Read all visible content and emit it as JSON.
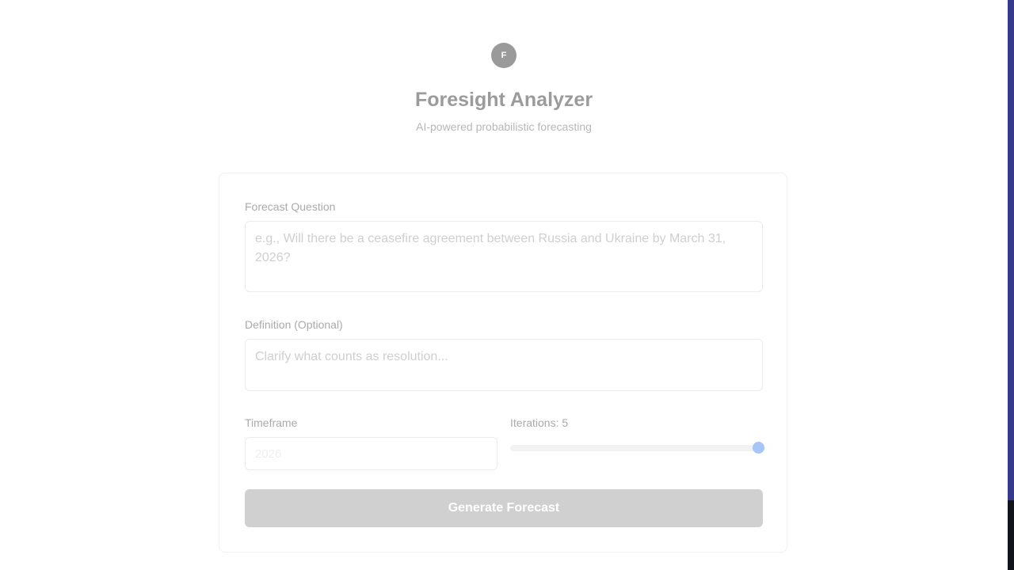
{
  "header": {
    "logo_letter": "F",
    "title": "Foresight Analyzer",
    "subtitle": "AI-powered probabilistic forecasting"
  },
  "form": {
    "question": {
      "label": "Forecast Question",
      "value": "",
      "placeholder": "e.g., Will there be a ceasefire agreement between Russia and Ukraine by March 31, 2026?"
    },
    "definition": {
      "label": "Definition (Optional)",
      "value": "",
      "placeholder": "Clarify what counts as resolution..."
    },
    "timeframe": {
      "label": "Timeframe",
      "value": "",
      "placeholder": "2026"
    },
    "iterations": {
      "label": "Iterations: 5",
      "value": 5,
      "min": 1,
      "max": 5
    },
    "submit_label": "Generate Forecast"
  },
  "colors": {
    "logo_bg": "#9a9a9a",
    "button_bg": "#d0d0d0",
    "slider_thumb": "#a7c5f5",
    "edge_strip": "#353a8a"
  }
}
